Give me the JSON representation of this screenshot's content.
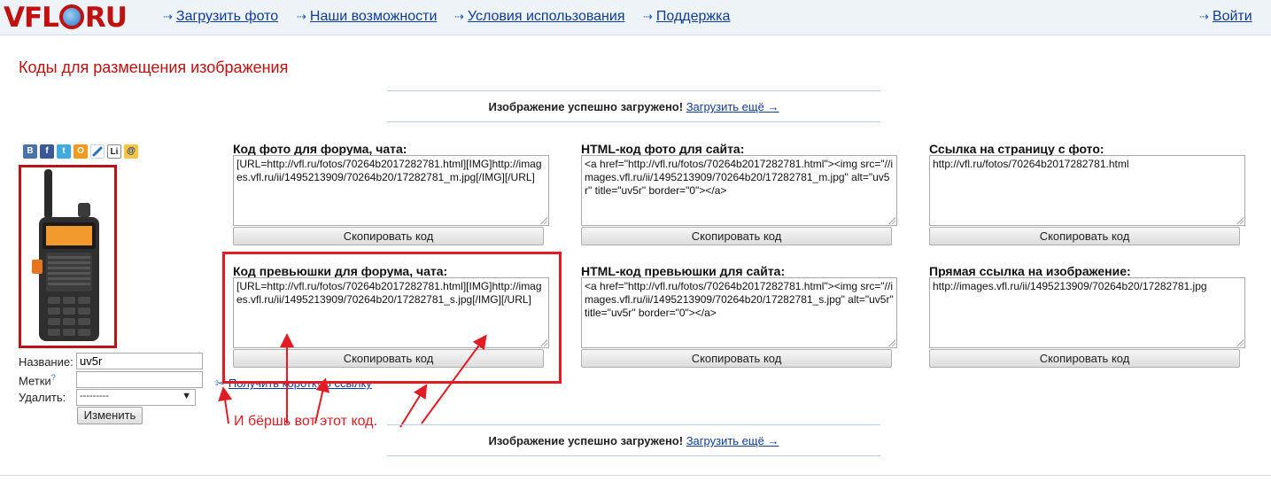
{
  "header": {
    "logo": {
      "left": "VFL",
      "right": "RU"
    },
    "nav": [
      {
        "label": "Загрузить фото"
      },
      {
        "label": "Наши возможности"
      },
      {
        "label": "Условия использования"
      },
      {
        "label": "Поддержка"
      }
    ],
    "login": "Войти"
  },
  "page_title": "Коды для размещения изображения",
  "banner": {
    "text": "Изображение успешно загружено!",
    "link": "Загрузить ещё →"
  },
  "share_icons": [
    "vkontakte-icon",
    "facebook-icon",
    "twitter-icon",
    "odnoklassniki-icon",
    "link-icon",
    "livejournal-icon",
    "email-icon"
  ],
  "share_letters": [
    "В",
    "f",
    "t",
    "О",
    "",
    "Li",
    "@"
  ],
  "form": {
    "name_label": "Название:",
    "name_value": "uv5r",
    "tags_label": "Метки",
    "tags_value": "",
    "delete_label": "Удалить:",
    "delete_value": "---------",
    "submit": "Изменить"
  },
  "blocks": [
    {
      "title": "Код фото для форума, чата:",
      "code": "[URL=http://vfl.ru/fotos/70264b2017282781.html][IMG]http://images.vfl.ru/ii/1495213909/70264b20/17282781_m.jpg[/IMG][/URL]",
      "button": "Скопировать код"
    },
    {
      "title": "HTML-код фото для сайта:",
      "code": "<a href=\"http://vfl.ru/fotos/70264b2017282781.html\"><img src=\"//images.vfl.ru/ii/1495213909/70264b20/17282781_m.jpg\" alt=\"uv5r\" title=\"uv5r\" border=\"0\"></a>",
      "button": "Скопировать код"
    },
    {
      "title": "Ссылка на страницу с фото:",
      "code": "http://vfl.ru/fotos/70264b2017282781.html",
      "button": "Скопировать код"
    },
    {
      "title": "Код превьюшки для форума, чата:",
      "code": "[URL=http://vfl.ru/fotos/70264b2017282781.html][IMG]http://images.vfl.ru/ii/1495213909/70264b20/17282781_s.jpg[/IMG][/URL]",
      "button": "Скопировать код"
    },
    {
      "title": "HTML-код превьюшки для сайта:",
      "code": "<a href=\"http://vfl.ru/fotos/70264b2017282781.html\"><img src=\"//images.vfl.ru/ii/1495213909/70264b20/17282781_s.jpg\" alt=\"uv5r\" title=\"uv5r\" border=\"0\"></a>",
      "button": "Скопировать код"
    },
    {
      "title": "Прямая ссылка на изображение:",
      "code": "http://images.vfl.ru/ii/1495213909/70264b20/17282781.jpg",
      "button": "Скопировать код"
    }
  ],
  "short_link": "Получить короткую ссылку",
  "annotation": "И бёршь вот этот код.",
  "colors": {
    "brand_red": "#c01010",
    "link_blue": "#0e3c9a",
    "annotation_red": "#e21c24"
  }
}
